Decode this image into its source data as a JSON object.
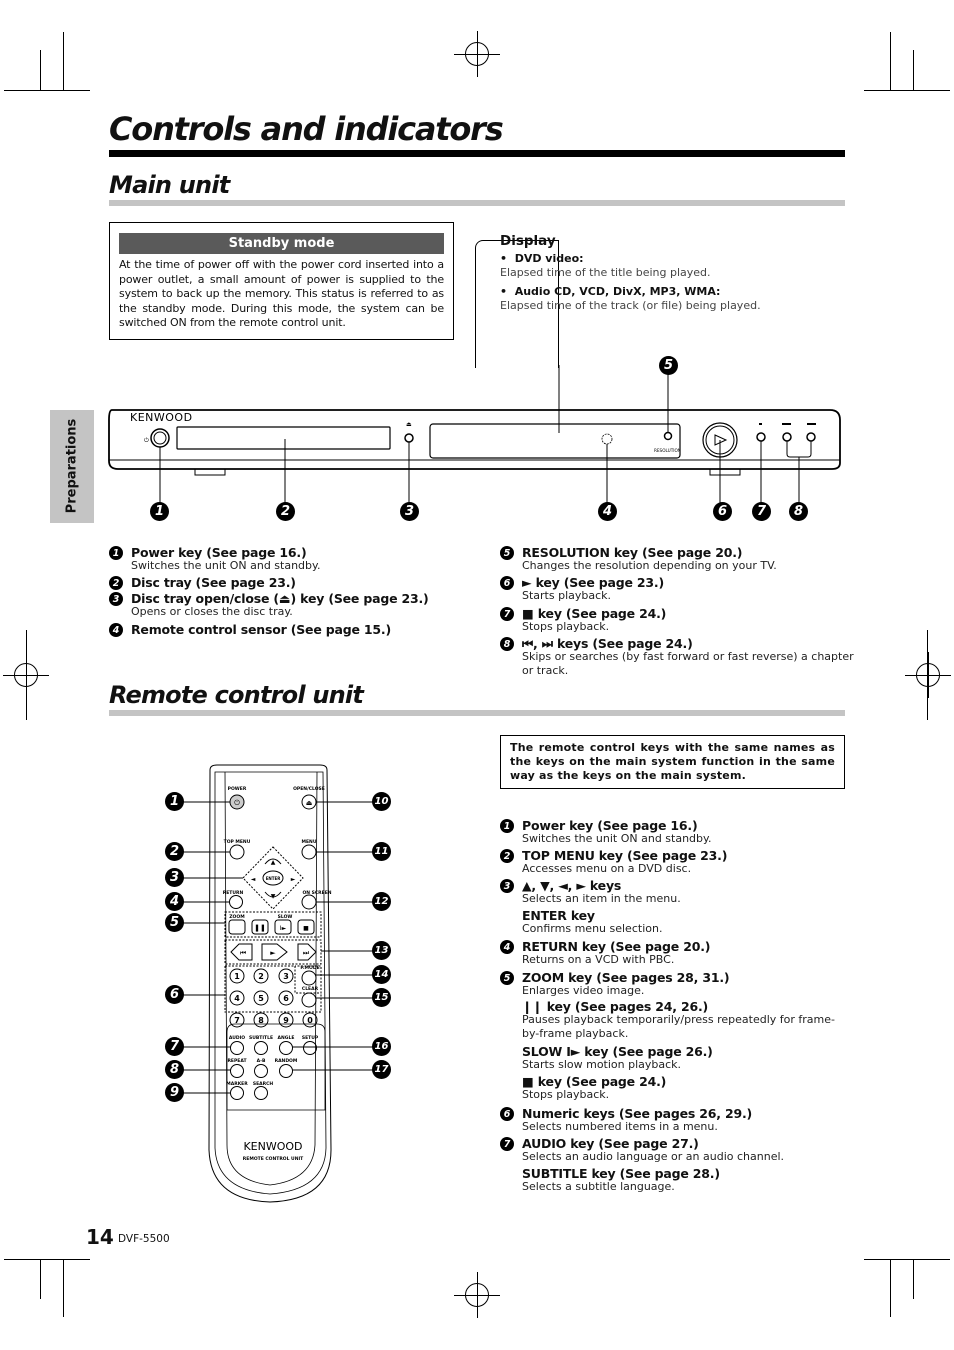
{
  "page": {
    "title": "Controls and indicators",
    "side_tab": "Preparations",
    "page_number": "14",
    "model": "DVF-5500"
  },
  "main_unit": {
    "heading": "Main unit",
    "standby": {
      "title": "Standby mode",
      "body": "At the time of power off with the power cord inserted into a power outlet, a small amount of power is supplied to the system to back up the memory. This status is referred to as the standby mode. During this mode, the system can be switched ON from the remote control unit."
    },
    "display": {
      "title": "Display",
      "items": [
        {
          "label": "DVD video:",
          "text": "Elapsed time of the title being played."
        },
        {
          "label": "Audio CD, VCD, DivX, MP3, WMA:",
          "text": "Elapsed time of the track (or file) being played."
        }
      ]
    },
    "device": {
      "brand": "KENWOOD",
      "resolution_label": "RESOLUTION",
      "callouts": [
        "1",
        "2",
        "3",
        "4",
        "5",
        "6",
        "7",
        "8"
      ]
    },
    "keys_left": [
      {
        "n": "1",
        "key": "Power key (See page 16.)",
        "desc": "Switches the unit ON and standby."
      },
      {
        "n": "2",
        "key": "Disc tray (See page 23.)",
        "desc": ""
      },
      {
        "n": "3",
        "key": "Disc tray open/close (⏏) key (See page 23.)",
        "desc": "Opens or closes the disc tray."
      },
      {
        "n": "4",
        "key": "Remote control sensor (See page 15.)",
        "desc": ""
      }
    ],
    "keys_right": [
      {
        "n": "5",
        "key": "RESOLUTION key (See page 20.)",
        "desc": "Changes the resolution depending on your TV."
      },
      {
        "n": "6",
        "key": "► key (See page 23.)",
        "desc": "Starts playback."
      },
      {
        "n": "7",
        "key": "■ key (See page 24.)",
        "desc": "Stops playback."
      },
      {
        "n": "8",
        "key": "⏮, ⏭ keys (See page 24.)",
        "desc": "Skips or searches (by fast forward or fast reverse) a chapter",
        "desc2": "or track."
      }
    ]
  },
  "remote_unit": {
    "heading": "Remote control unit",
    "note": "The remote control keys with the same names as the keys on the main system function in the same way as the keys on the main system.",
    "remote": {
      "brand": "KENWOOD",
      "subtitle": "REMOTE CONTROL UNIT",
      "labels": {
        "power": "POWER",
        "open_close": "OPEN/CLOSE",
        "top_menu": "TOP MENU",
        "menu": "MENU",
        "enter": "ENTER",
        "return": "RETURN",
        "on_screen": "ON SCREEN",
        "zoom": "ZOOM",
        "slow": "SLOW",
        "pmode": "P.MODE",
        "clear": "CLEAR",
        "audio": "AUDIO",
        "subtitle": "SUBTITLE",
        "angle": "ANGLE",
        "setup": "SETUP",
        "repeat": "REPEAT",
        "ab": "A-B",
        "random": "RANDOM",
        "marker": "MARKER",
        "search": "SEARCH"
      },
      "numbers": [
        "1",
        "2",
        "3",
        "4",
        "5",
        "6",
        "7",
        "8",
        "9",
        "0"
      ],
      "callouts_left": [
        "1",
        "2",
        "3",
        "4",
        "5",
        "6",
        "7",
        "8",
        "9"
      ],
      "callouts_right": [
        "10",
        "11",
        "12",
        "13",
        "14",
        "15",
        "16",
        "17"
      ]
    },
    "keys": [
      {
        "n": "1",
        "key": "Power key (See page 16.)",
        "desc": "Switches the unit ON and standby."
      },
      {
        "n": "2",
        "key": "TOP MENU key (See page 23.)",
        "desc": "Accesses menu on a DVD disc."
      },
      {
        "n": "3",
        "key": "▲, ▼, ◄, ► keys",
        "desc": "Selects an item in the menu."
      },
      {
        "n": "",
        "key": "ENTER key",
        "desc": "Confirms menu selection."
      },
      {
        "n": "4",
        "key": "RETURN key (See page 20.)",
        "desc": "Returns on a VCD with PBC."
      },
      {
        "n": "5",
        "key": "ZOOM key (See pages 28, 31.)",
        "desc": "Enlarges video image."
      },
      {
        "n": "",
        "key": "❙❙ key (See pages 24, 26.)",
        "desc": "Pauses playback temporarily/press repeatedly for frame-",
        "desc2": "by-frame playback."
      },
      {
        "n": "",
        "key": "SLOW I► key  (See page 26.)",
        "desc": "Starts slow motion playback."
      },
      {
        "n": "",
        "key": "■ key (See page 24.)",
        "desc": "Stops playback."
      },
      {
        "n": "6",
        "key": "Numeric keys (See pages 26, 29.)",
        "desc": "Selects numbered items in a menu."
      },
      {
        "n": "7",
        "key": "AUDIO key (See page 27.)",
        "desc": "Selects an audio language or an audio channel."
      },
      {
        "n": "",
        "key": "SUBTITLE key (See page 28.)",
        "desc": "Selects a subtitle language."
      }
    ]
  }
}
